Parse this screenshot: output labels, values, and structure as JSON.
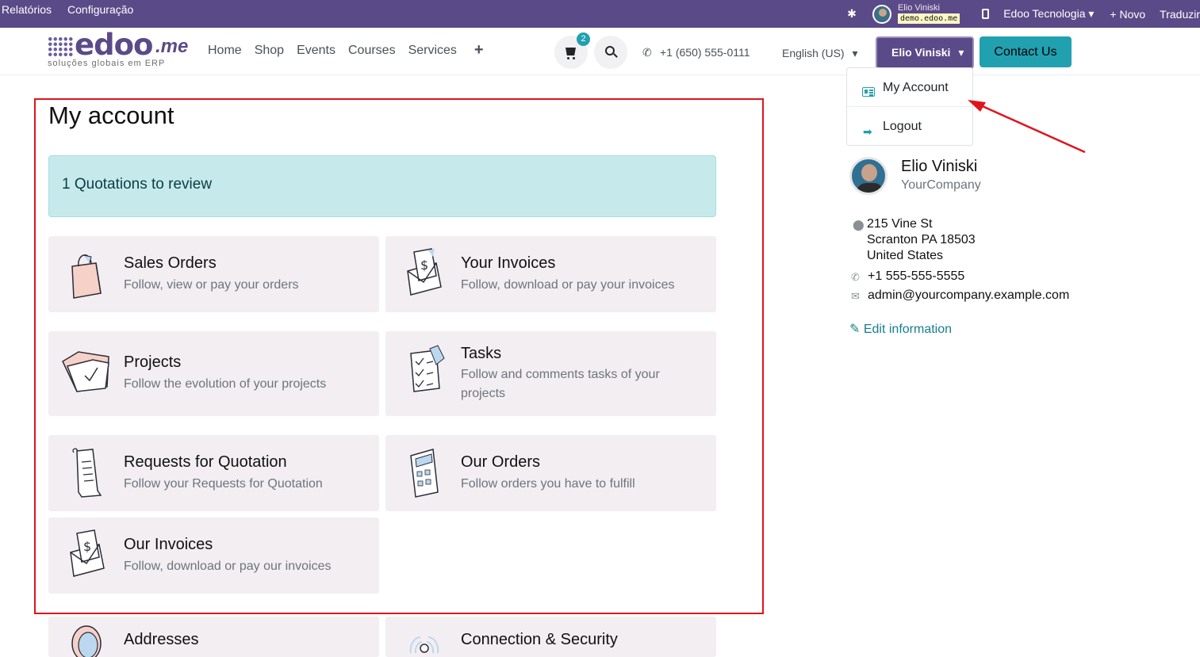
{
  "adminbar": {
    "menu": [
      "Relatórios",
      "Configuração"
    ],
    "user_name": "Elio Viniski",
    "database": "demo.edoo.me",
    "company": "Edoo Tecnologia",
    "new_label": "+ Novo",
    "translate_label": "Traduzir"
  },
  "brand": {
    "word": "edoo",
    "suffix": ".me",
    "tagline": "soluções globais em ERP"
  },
  "nav": {
    "items": [
      "Home",
      "Shop",
      "Events",
      "Courses",
      "Services"
    ],
    "plus": "+",
    "cart_count": "2",
    "phone": "+1 (650) 555-0111",
    "language": "English (US)",
    "user_button": "Elio Viniski",
    "contact_button": "Contact Us"
  },
  "dropdown": {
    "my_account": "My Account",
    "logout": "Logout"
  },
  "page": {
    "title": "My account",
    "alert": "1  Quotations to review"
  },
  "cards": [
    {
      "title": "Sales Orders",
      "desc": "Follow, view or pay your orders"
    },
    {
      "title": "Your Invoices",
      "desc": "Follow, download or pay your invoices"
    },
    {
      "title": "Projects",
      "desc": "Follow the evolution of your projects"
    },
    {
      "title": "Tasks",
      "desc": "Follow and comments tasks of your projects"
    },
    {
      "title": "Requests for Quotation",
      "desc": "Follow your Requests for Quotation"
    },
    {
      "title": "Our Orders",
      "desc": "Follow orders you have to fulfill"
    },
    {
      "title": "Our Invoices",
      "desc": "Follow, download or pay our invoices"
    },
    {
      "title": "Addresses",
      "desc": ""
    },
    {
      "title": "Connection & Security",
      "desc": ""
    }
  ],
  "profile": {
    "name": "Elio Viniski",
    "company": "YourCompany",
    "address_line1": "215 Vine St",
    "address_line2": "Scranton PA 18503",
    "address_line3": "United States",
    "phone": "+1 555-555-5555",
    "email": "admin@yourcompany.example.com",
    "edit_label": "Edit information"
  },
  "colors": {
    "admin_bar": "#5b4a88",
    "accent": "#21a0b0",
    "card_bg": "#f3eef1",
    "highlight": "#e0141c"
  }
}
